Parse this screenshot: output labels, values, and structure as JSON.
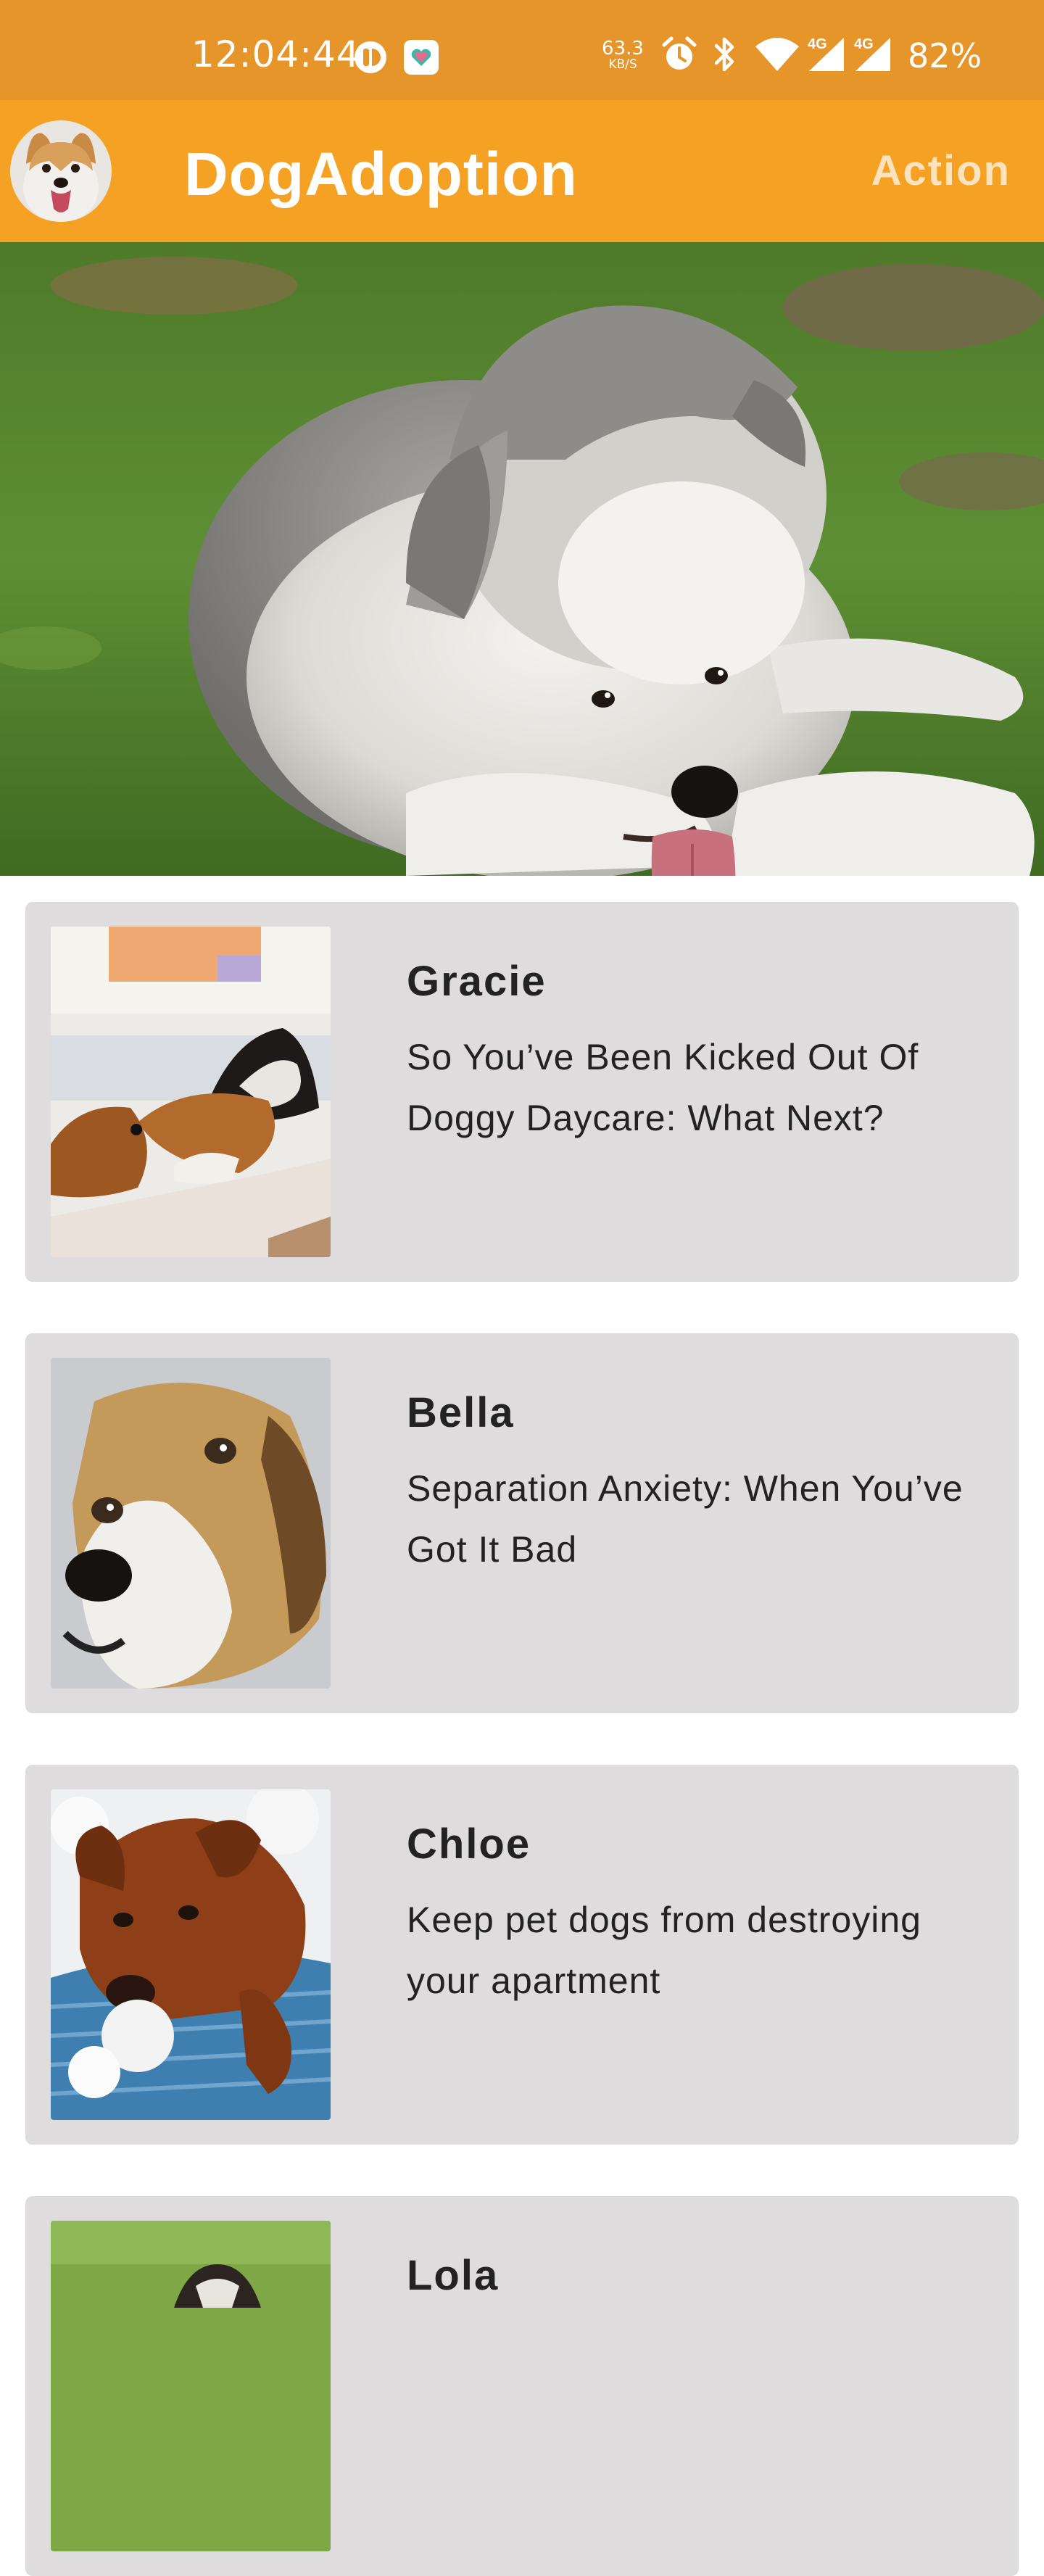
{
  "status_bar": {
    "time": "12:04:44",
    "net_speed": "63.3",
    "net_unit": "KB/S",
    "signal_1": "4G",
    "signal_2": "4G",
    "battery": "82%"
  },
  "app_bar": {
    "title": "DogAdoption",
    "action": "Action"
  },
  "dogs": [
    {
      "name": "Gracie",
      "description": "So You’ve Been Kicked Out Of Doggy Daycare: What Next?"
    },
    {
      "name": "Bella",
      "description": "Separation Anxiety: When You’ve Got It Bad"
    },
    {
      "name": "Chloe",
      "description": "Keep pet dogs from destroying your apartment"
    },
    {
      "name": "Lola",
      "description": ""
    }
  ],
  "colors": {
    "status_bar": "#E6952A",
    "app_bar": "#F4A124",
    "card_background": "#DEDCDD"
  }
}
